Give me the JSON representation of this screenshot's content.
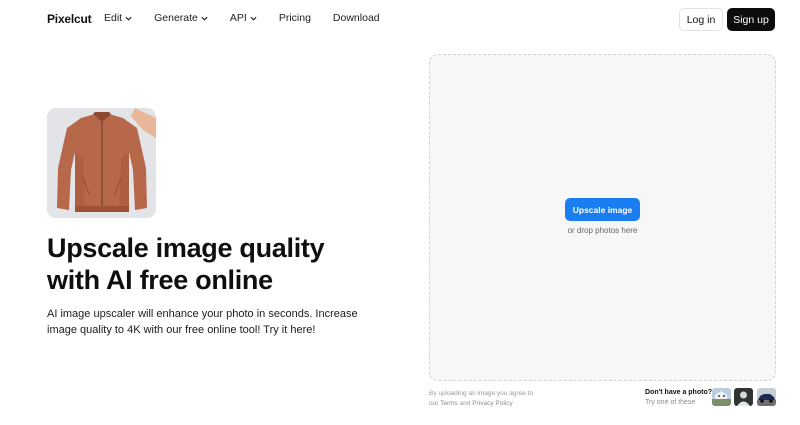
{
  "nav": {
    "logo": "Pixelcut",
    "links": [
      {
        "label": "Edit",
        "has_dropdown": true
      },
      {
        "label": "Generate",
        "has_dropdown": true
      },
      {
        "label": "API",
        "has_dropdown": true
      },
      {
        "label": "Pricing",
        "has_dropdown": false
      },
      {
        "label": "Download",
        "has_dropdown": false
      }
    ],
    "login_label": "Log in",
    "signup_label": "Sign up"
  },
  "hero": {
    "image_icon": "jacket-photo",
    "title": "Upscale image quality with AI free online",
    "description": "AI image upscaler will enhance your photo in seconds. Increase image quality to 4K with our free online tool! Try it here!"
  },
  "upload": {
    "button_label": "Upscale image",
    "hint": "or drop photos here",
    "terms_prefix": "By uploading an image you agree to",
    "terms_our": "our",
    "terms_link": "Terms",
    "terms_and": "and",
    "privacy_link": "Privacy Policy",
    "sample_title": "Don't have a photo?",
    "sample_subtitle": "Try one of these",
    "samples": [
      "sample-house-photo",
      "sample-portrait-photo",
      "sample-car-photo"
    ]
  },
  "colors": {
    "accent": "#1a7ef2",
    "signup_bg": "#0c0c0c",
    "dropzone_bg": "#f7f7f7"
  }
}
